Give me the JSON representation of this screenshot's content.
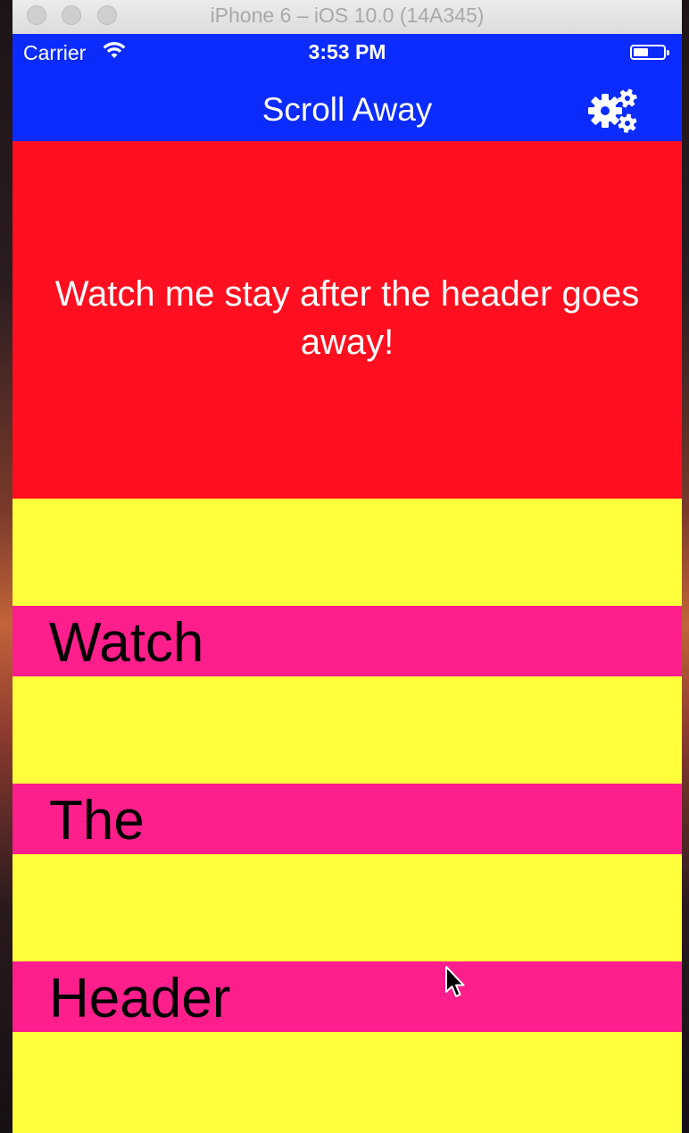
{
  "window": {
    "title": "iPhone 6 – iOS 10.0 (14A345)"
  },
  "status_bar": {
    "carrier": "Carrier",
    "time": "3:53 PM",
    "wifi_icon": "wifi-icon",
    "battery_icon": "battery-icon"
  },
  "nav_bar": {
    "title": "Scroll Away",
    "settings_icon": "gears-icon"
  },
  "hero": {
    "text": "Watch me stay after the header goes away!"
  },
  "sections": [
    {
      "label": "Watch"
    },
    {
      "label": "The"
    },
    {
      "label": "Header"
    }
  ],
  "colors": {
    "nav_blue": "#0b2bff",
    "hero_red": "#ff0f1f",
    "cell_yellow": "#ffff3c",
    "section_pink": "#ff1f8c"
  }
}
